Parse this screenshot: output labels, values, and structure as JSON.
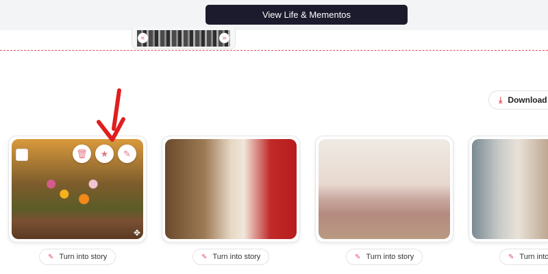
{
  "header": {
    "view_button": "View Life & Mementos"
  },
  "filmstrip": {
    "prev_icon": "double-chevron-left",
    "next_icon": "double-chevron-right"
  },
  "toolbar": {
    "download_label": "Download",
    "download_icon": "download-icon"
  },
  "cards": [
    {
      "story_label": "Turn into story",
      "actions": [
        "trash-icon",
        "star-icon",
        "pencil-icon"
      ]
    },
    {
      "story_label": "Turn into story"
    },
    {
      "story_label": "Turn into story"
    },
    {
      "story_label": "Turn into story"
    }
  ],
  "colors": {
    "accent": "#e0505f",
    "dark_button": "#1c1b2e",
    "annotation_arrow": "#e01e1e"
  }
}
